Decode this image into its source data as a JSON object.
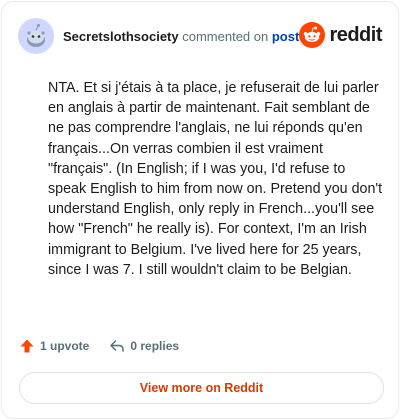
{
  "header": {
    "username": "Secretslothsociety",
    "action_text": "commented on",
    "post_link": "post",
    "logo_text": "reddit"
  },
  "comment": {
    "text": "NTA. Et si j'étais à ta place, je refuserait de lui parler en anglais à partir de maintenant. Fait semblant de ne pas comprendre l'anglais, ne lui réponds qu'en français...On verras combien il est vraiment \"français\". (In English; if I was you, I'd refuse to speak English to him from now on. Pretend you don't understand English, only reply in French...you'll see how \"French\" he really is). For context, I'm an Irish immigrant to Belgium. I've lived here for 25 years, since I was 7. I still wouldn't claim to be Belgian."
  },
  "actions": {
    "upvotes": "1 upvote",
    "replies": "0 replies"
  },
  "footer": {
    "view_more": "View more on Reddit"
  },
  "icons": {
    "avatar": "snoo-avatar-icon",
    "logo": "reddit-logo-icon",
    "upvote": "upvote-arrow-icon",
    "reply": "reply-arrow-icon"
  },
  "colors": {
    "brand_orange": "#ff4500",
    "link_blue": "#0045ac",
    "muted_text": "#576f76",
    "view_more_text": "#d93a00",
    "card_border": "#e5ebee",
    "avatar_bg": "#cfd7ff"
  }
}
